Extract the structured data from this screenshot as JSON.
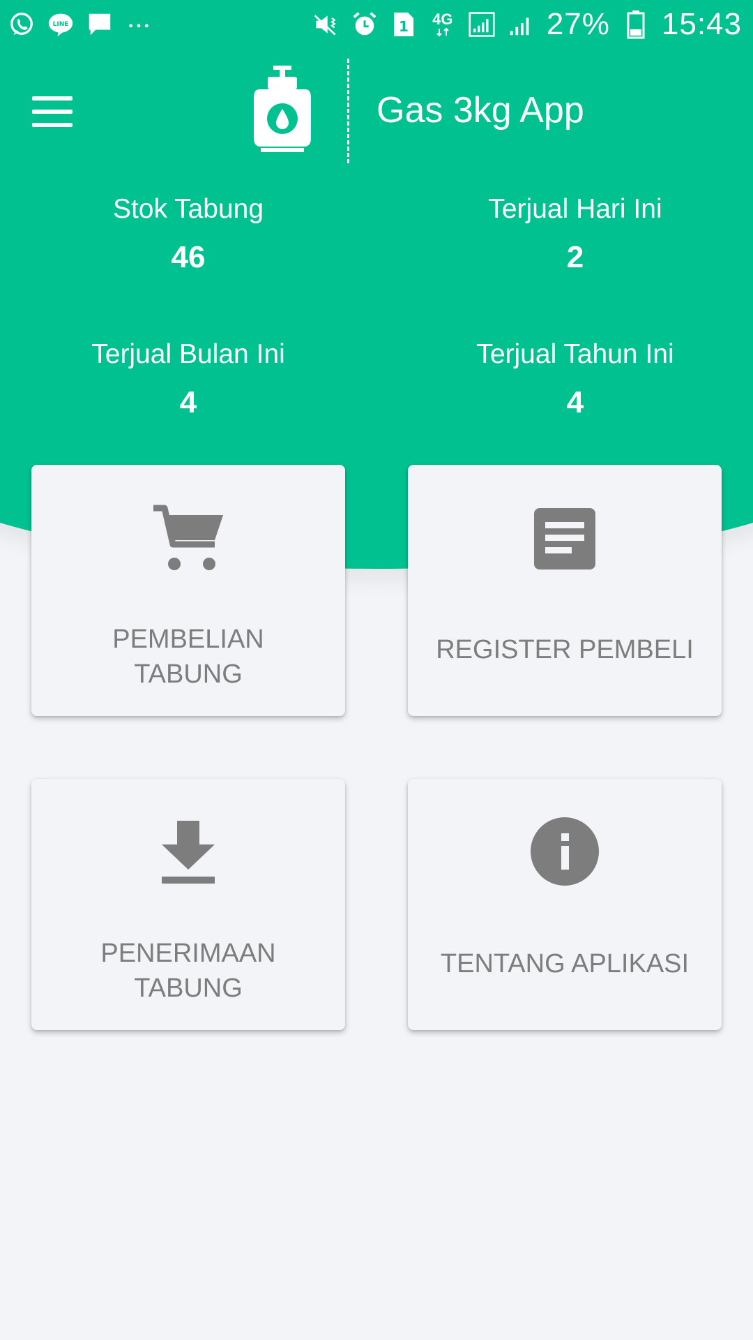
{
  "status_bar": {
    "battery_percent": "27%",
    "time": "15:43",
    "sim_slot": "1",
    "network": "4G",
    "more": "···"
  },
  "app_bar": {
    "title": "Gas 3kg App"
  },
  "stats": [
    {
      "label": "Stok Tabung",
      "value": "46"
    },
    {
      "label": "Terjual Hari Ini",
      "value": "2"
    },
    {
      "label": "Terjual Bulan Ini",
      "value": "4"
    },
    {
      "label": "Terjual Tahun Ini",
      "value": "4"
    }
  ],
  "menu": [
    {
      "label_line1": "PEMBELIAN",
      "label_line2": "TABUNG",
      "icon": "cart-icon"
    },
    {
      "label_line1": "REGISTER PEMBELI",
      "label_line2": "",
      "icon": "document-icon"
    },
    {
      "label_line1": "PENERIMAAN",
      "label_line2": "TABUNG",
      "icon": "download-icon"
    },
    {
      "label_line1": "TENTANG APLIKASI",
      "label_line2": "",
      "icon": "info-icon"
    }
  ],
  "colors": {
    "primary": "#02c190",
    "background": "#f3f4f8",
    "card_text": "#7d7d7d",
    "icon_gray": "#7d7d7d"
  }
}
